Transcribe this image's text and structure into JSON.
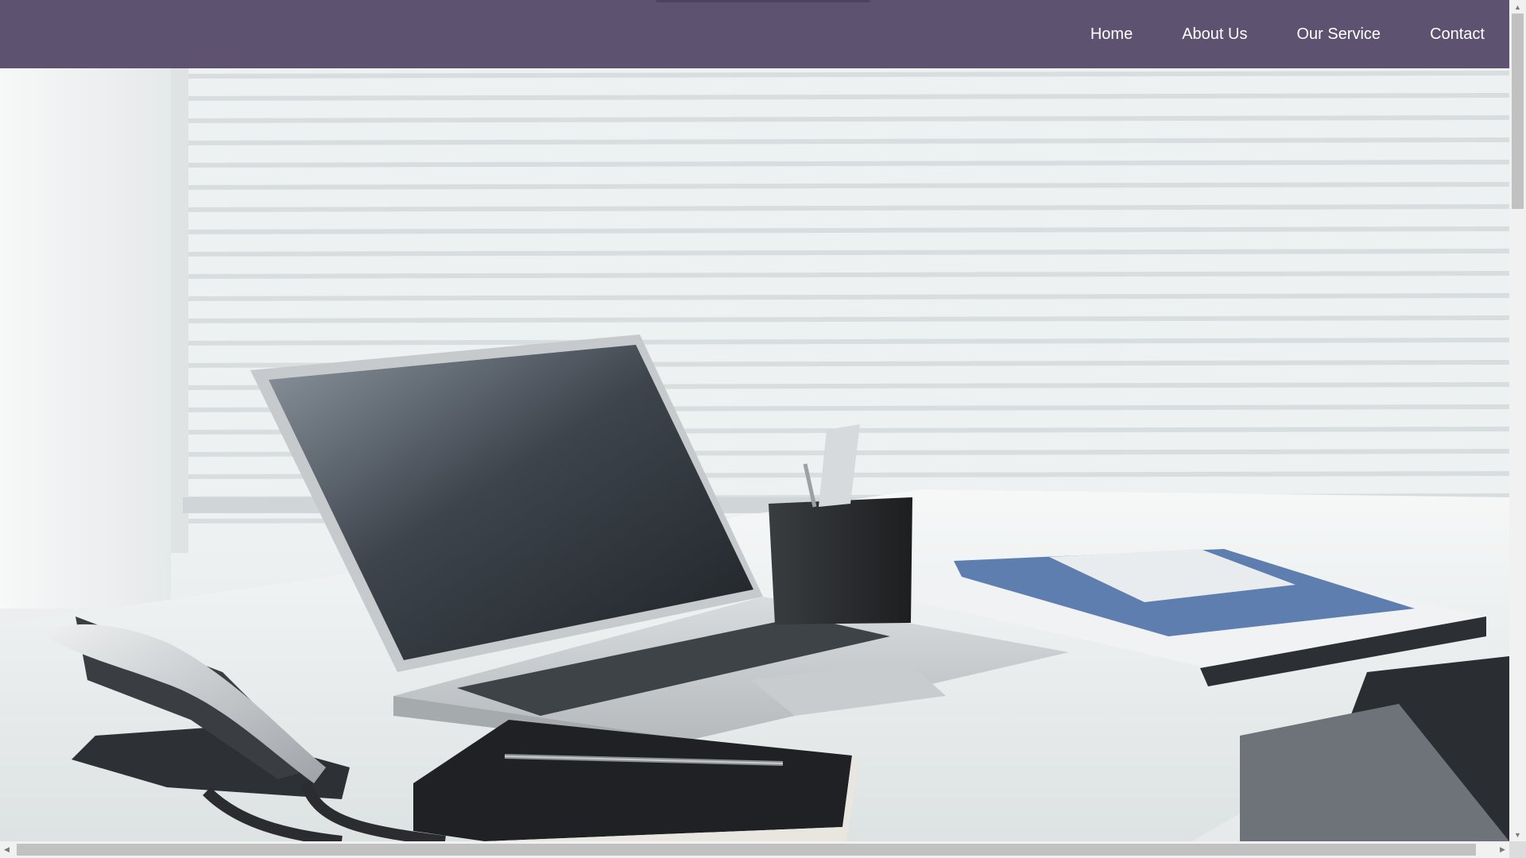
{
  "nav": {
    "items": [
      {
        "label": "Home"
      },
      {
        "label": "About Us"
      },
      {
        "label": "Our Service"
      },
      {
        "label": "Contact"
      }
    ]
  },
  "hero": {
    "image_description_icon": "office-desk-photo"
  },
  "colors": {
    "navbar": "#5d5371",
    "nav_text": "#ffffff"
  },
  "scrollbars": {
    "vertical_arrow_up": "▲",
    "vertical_arrow_down": "▼",
    "horizontal_arrow_left": "◀",
    "horizontal_arrow_right": "▶"
  }
}
